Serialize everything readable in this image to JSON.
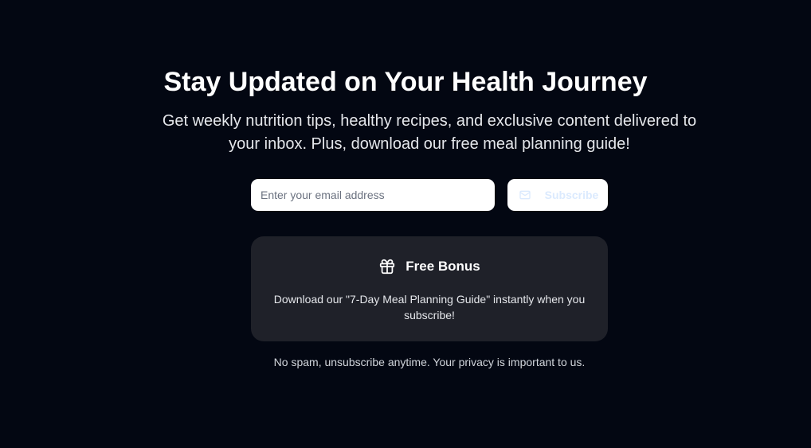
{
  "newsletter": {
    "title": "Stay Updated on Your Health Journey",
    "subtitle": "Get weekly nutrition tips, healthy recipes, and exclusive content delivered to your inbox. Plus, download our free meal planning guide!",
    "email_value": "",
    "email_placeholder": "Enter your email address",
    "subscribe_label": "Subscribe",
    "subscribe_icon": "mail-icon",
    "bonus": {
      "icon": "gift-icon",
      "title": "Free Bonus",
      "text": "Download our \"7-Day Meal Planning Guide\" instantly when you subscribe!"
    },
    "privacy_note": "No spam, unsubscribe anytime. Your privacy is important to us."
  },
  "colors": {
    "background": "#030712",
    "card": "#1f2129",
    "button_bg": "#ffffff",
    "button_text": "#dbeafe",
    "heading_text": "#ffffff",
    "body_text": "#e5e7eb"
  }
}
